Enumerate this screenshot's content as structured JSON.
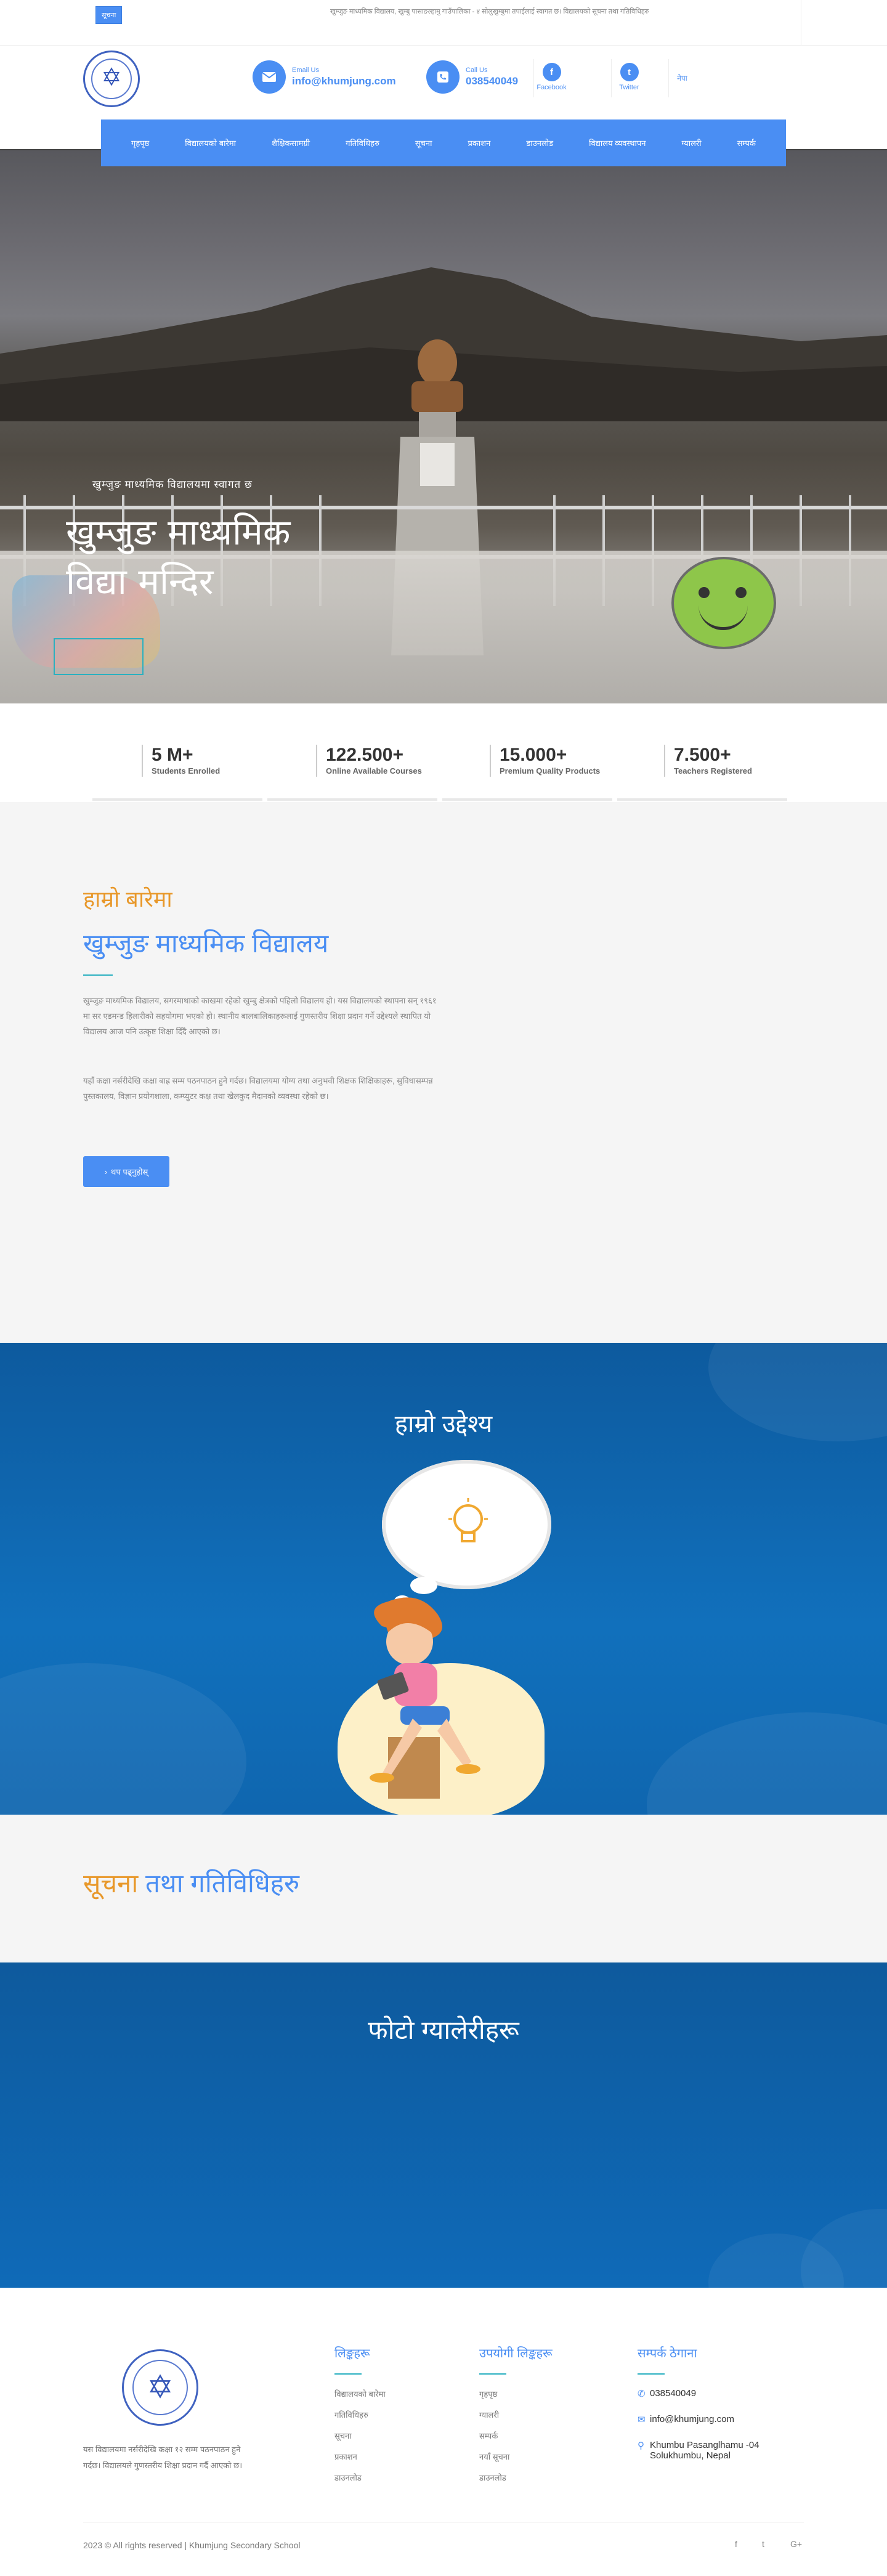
{
  "topbar": {
    "notice_label": "सूचना",
    "marquee_text": "खुम्जुङ माध्यमिक विद्यालय, खुम्बु पासाङल्हामु गाउँपालिका - ४ सोलुखुम्बुमा तपाईंलाई स्वागत छ। विद्यालयको सूचना तथा गतिविधिहरु"
  },
  "header": {
    "email_label": "Email Us",
    "email_value": "info@khumjung.com",
    "phone_label": "Call Us",
    "phone_value": "038540049",
    "facebook_label": "Facebook",
    "twitter_label": "Twitter",
    "lang_label": "नेपा"
  },
  "nav": {
    "items": [
      "गृहपृष्ठ",
      "विद्यालयको बारेमा",
      "शैक्षिकसामग्री",
      "गतिविधिहरु",
      "सूचना",
      "प्रकाशन",
      "डाउनलोड",
      "विद्यालय व्यवस्थापन",
      "ग्यालरी",
      "सम्पर्क"
    ]
  },
  "hero": {
    "caption_small": "खुम्जुङ माध्यमिक विद्यालयमा स्वागत छ",
    "caption_line1": "खुम्जुङ माध्यमिक",
    "caption_line2": "विद्या मन्दिर"
  },
  "stats": [
    {
      "num": "5 M+",
      "caption": "Students Enrolled"
    },
    {
      "num": "122.500+",
      "caption": "Online Available Courses"
    },
    {
      "num": "15.000+",
      "caption": "Premium Quality Products"
    },
    {
      "num": "7.500+",
      "caption": "Teachers Registered"
    }
  ],
  "about": {
    "title_small": "हाम्रो बारेमा",
    "title_big": "खुम्जुङ माध्यमिक विद्यालय",
    "paragraph1": "खुम्जुङ माध्यमिक विद्यालय, सगरमाथाको काखमा रहेको खुम्बु क्षेत्रको पहिलो विद्यालय हो। यस विद्यालयको स्थापना सन् १९६१ मा सर एडमन्ड हिलारीको सहयोगमा भएको हो। स्थानीय बालबालिकाहरूलाई गुणस्तरीय शिक्षा प्रदान गर्ने उद्देश्यले स्थापित यो विद्यालय आज पनि उत्कृष्ट शिक्षा दिँदै आएको छ।",
    "paragraph2": "यहाँ कक्षा नर्सरीदेखि कक्षा बाह्र सम्म पठनपाठन हुने गर्दछ। विद्यालयमा योग्य तथा अनुभवी शिक्षक शिक्षिकाहरू, सुविधासम्पन्न पुस्तकालय, विज्ञान प्रयोगशाला, कम्प्युटर कक्ष तथा खेलकुद मैदानको व्यवस्था रहेको छ।",
    "button_label": "थप पढ्नुहोस्"
  },
  "think": {
    "title": "हाम्रो उद्देश्य"
  },
  "notices": {
    "title_part1": "सूचना",
    "title_part2": "तथा गतिविधिहरु"
  },
  "gallery": {
    "title": "फोटो ग्यालेरीहरू"
  },
  "footer": {
    "about_text": "यस विद्यालयमा नर्सरीदेखि कक्षा १२ सम्म पठनपाठन हुने गर्दछ। विद्यालयले गुणस्तरीय शिक्षा प्रदान गर्दै आएको छ।",
    "col1_title": "लिङ्कहरू",
    "col1_items": [
      "विद्यालयको बारेमा",
      "गतिविधिहरु",
      "सूचना",
      "प्रकाशन",
      "डाउनलोड"
    ],
    "col2_title": "उपयोगी लिङ्कहरू",
    "col2_items": [
      "गृहपृष्ठ",
      "ग्यालरी",
      "सम्पर्क",
      "नयाँ सूचना",
      "डाउनलोड"
    ],
    "col3_title": "सम्पर्क ठेगाना",
    "phone": "038540049",
    "email": "info@khumjung.com",
    "address_line1": "Khumbu Pasanglhamu -04",
    "address_line2": "Solukhumbu, Nepal",
    "copyright": "2023 © All rights reserved | Khumjung Secondary School",
    "social_facebook": "f",
    "social_twitter": "t",
    "social_google": "G+"
  },
  "colors": {
    "accent": "#4a8ef3",
    "orange": "#e8982a",
    "teal": "#2ab0c0",
    "navy": "#0e5a9d"
  }
}
